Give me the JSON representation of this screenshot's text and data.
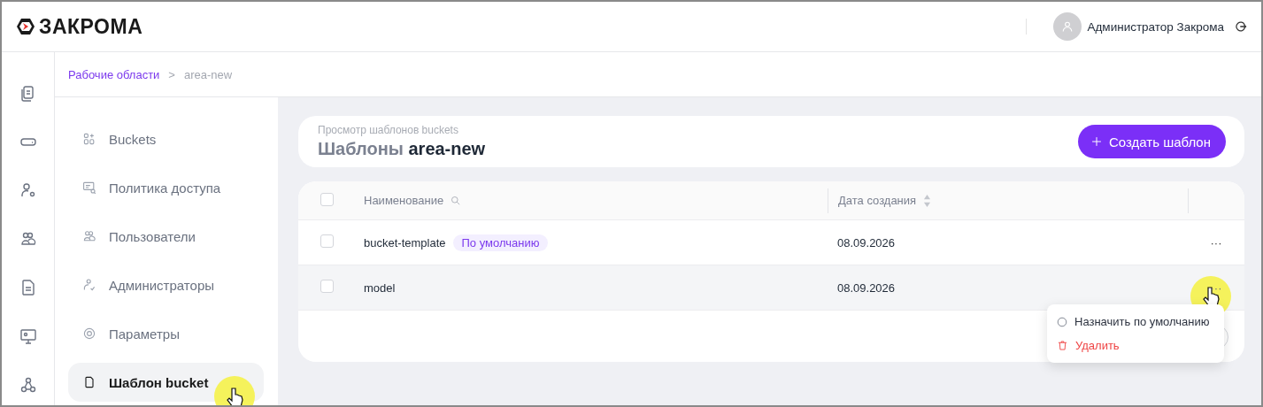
{
  "app": {
    "logo": "ЗАКРОМА",
    "user": "Администратор Закрома"
  },
  "breadcrumb": {
    "items": [
      {
        "label": "Рабочие области",
        "kind": "link"
      },
      {
        "label": "area-new",
        "kind": "current"
      }
    ],
    "separator": ">"
  },
  "side_menu": [
    {
      "label": "Buckets",
      "selected": false
    },
    {
      "label": "Политика доступа",
      "selected": false
    },
    {
      "label": "Пользователи",
      "selected": false
    },
    {
      "label": "Администраторы",
      "selected": false
    },
    {
      "label": "Параметры",
      "selected": false
    },
    {
      "label": "Шаблон bucket",
      "selected": true
    }
  ],
  "page": {
    "subtitle": "Просмотр шаблонов buckets",
    "title": "Шаблоны",
    "title_name": "area-new",
    "create_button": "Создать шаблон"
  },
  "table": {
    "select_all_checked": false,
    "columns": [
      {
        "label": "Наименование",
        "kind": "search"
      },
      {
        "label": "Дата создания",
        "kind": "sort"
      }
    ],
    "rows": [
      {
        "name": "bucket-template",
        "tag": "По умолчанию",
        "date": "08.09.2026",
        "actions": "···",
        "checked": false,
        "hovered": false
      },
      {
        "name": "model",
        "date": "08.09.2026",
        "actions": "···",
        "checked": false,
        "hovered": true
      }
    ]
  },
  "context_menu": [
    {
      "label": "Назначить по умолчанию",
      "kind": "default"
    },
    {
      "label": "Удалить",
      "kind": "delete"
    }
  ]
}
